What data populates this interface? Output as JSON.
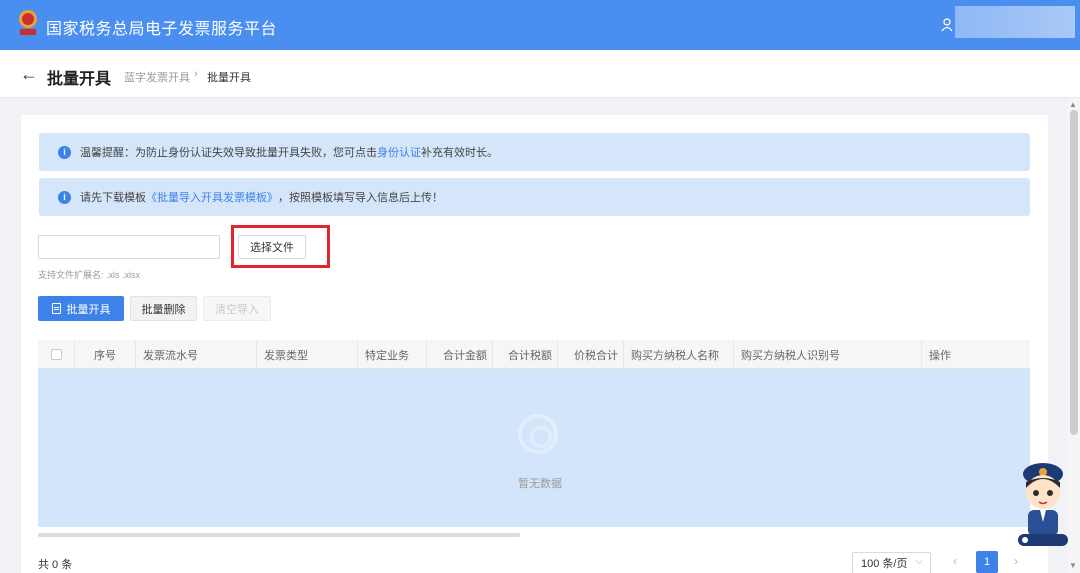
{
  "header": {
    "app_title": "国家税务总局电子发票服务平台",
    "colors": {
      "bar": "#4a8ef0"
    }
  },
  "subheader": {
    "back_icon": "arrow-left-icon",
    "page_title": "批量开具",
    "breadcrumb": [
      "蓝字发票开具",
      "批量开具"
    ]
  },
  "alerts": [
    {
      "prefix": "温馨提醒：为防止身份认证失效导致批量开具失败，您可点击",
      "link": "身份认证",
      "suffix": "补充有效时长。"
    },
    {
      "prefix": "请先下载模板",
      "link": "《批量导入开具发票模板》",
      "suffix": "，按照模板填写导入信息后上传！"
    }
  ],
  "upload": {
    "choose_label": "选择文件",
    "hint": "支持文件扩展名: .xls .xlsx"
  },
  "toolbar": {
    "batch_issue": "批量开具",
    "batch_delete": "批量删除",
    "clear_import": "清空导入"
  },
  "table": {
    "columns": [
      "序号",
      "发票流水号",
      "发票类型",
      "特定业务",
      "合计金额",
      "合计税额",
      "价税合计",
      "购买方纳税人名称",
      "购买方纳税人识别号",
      "操作"
    ],
    "empty_text": "暂无数据"
  },
  "footer": {
    "total": "共 0 条",
    "page_size": "100 条/页",
    "current_page": "1"
  }
}
